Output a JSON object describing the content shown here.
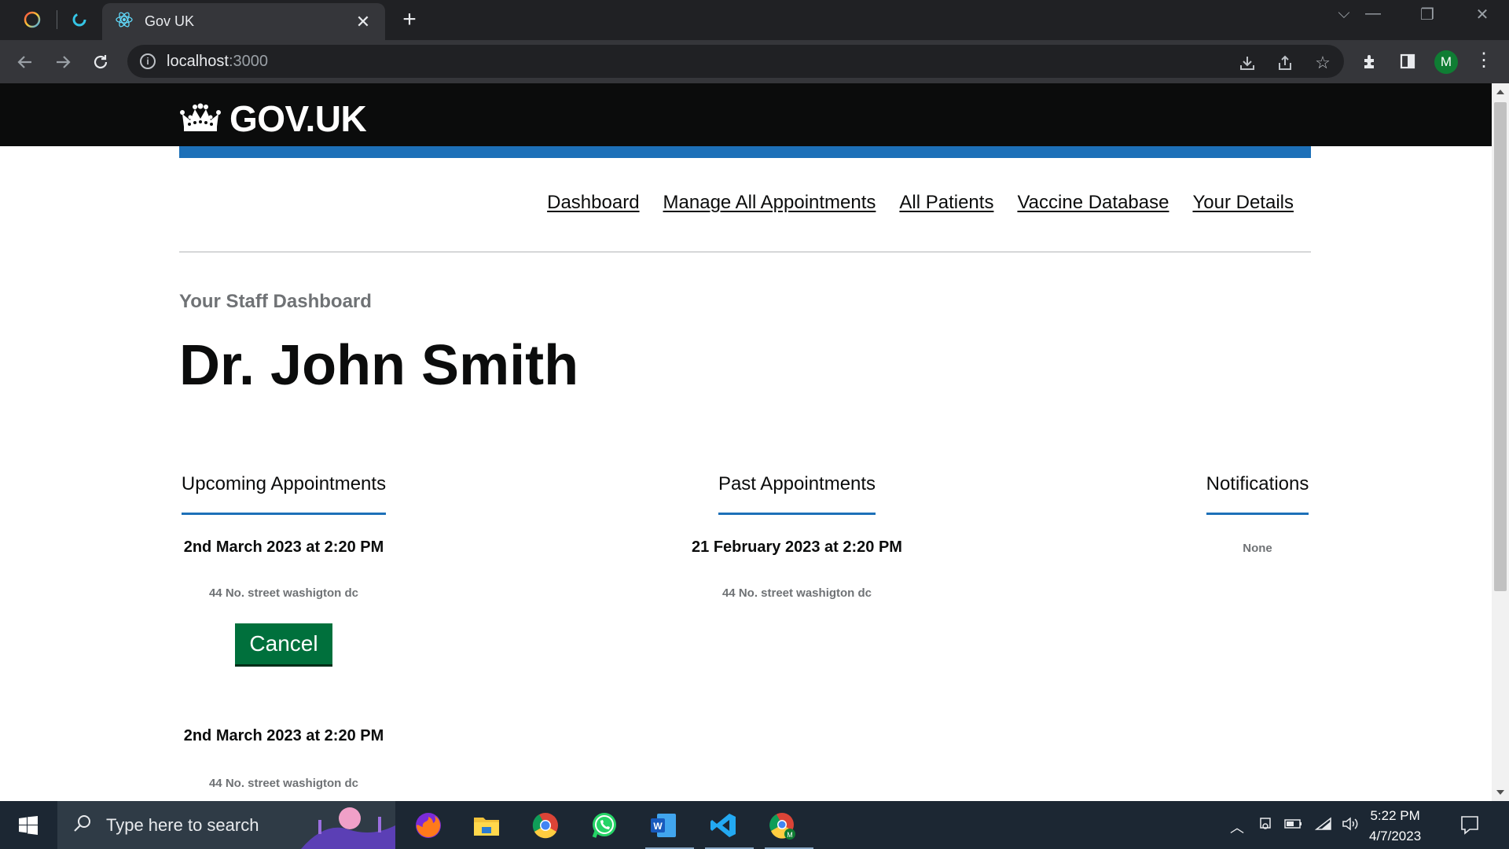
{
  "browser": {
    "tab_title": "Gov UK",
    "close_symbol": "✕",
    "new_tab_symbol": "+",
    "url_host": "localhost",
    "url_port": ":3000",
    "profile_initial": "M"
  },
  "site": {
    "logo_text": "GOV.UK",
    "brand_blue": "#1d70b8",
    "header_black": "#0b0c0c"
  },
  "nav": {
    "items": [
      "Dashboard",
      "Manage All Appointments",
      "All Patients",
      "Vaccine Database",
      "Your Details"
    ]
  },
  "page": {
    "caption": "Your Staff Dashboard",
    "title": "Dr. John Smith"
  },
  "upcoming": {
    "heading": "Upcoming Appointments",
    "items": [
      {
        "time": "2nd March 2023 at 2:20 PM",
        "address": "44 No. street washigton dc",
        "action": "Cancel"
      },
      {
        "time": "2nd March 2023 at 2:20 PM",
        "address": "44 No. street washigton dc"
      }
    ]
  },
  "past": {
    "heading": "Past Appointments",
    "items": [
      {
        "time": "21 February 2023 at 2:20 PM",
        "address": "44 No. street washigton dc"
      }
    ]
  },
  "notifications": {
    "heading": "Notifications",
    "empty_text": "None"
  },
  "taskbar": {
    "search_placeholder": "Type here to search",
    "time": "5:22 PM",
    "date": "4/7/2023"
  },
  "icons": [
    "circle-app-icon",
    "extension-app-icon",
    "react-icon",
    "back-arrow-icon",
    "forward-arrow-icon",
    "reload-icon",
    "info-icon",
    "install-icon",
    "share-icon",
    "star-icon",
    "puzzle-icon",
    "side-panel-icon",
    "crown-icon",
    "windows-icon",
    "search-icon",
    "firefox-icon",
    "file-explorer-icon",
    "chrome-icon",
    "whatsapp-icon",
    "word-icon",
    "vscode-icon",
    "chrome-profile-icon",
    "notification-icon"
  ]
}
